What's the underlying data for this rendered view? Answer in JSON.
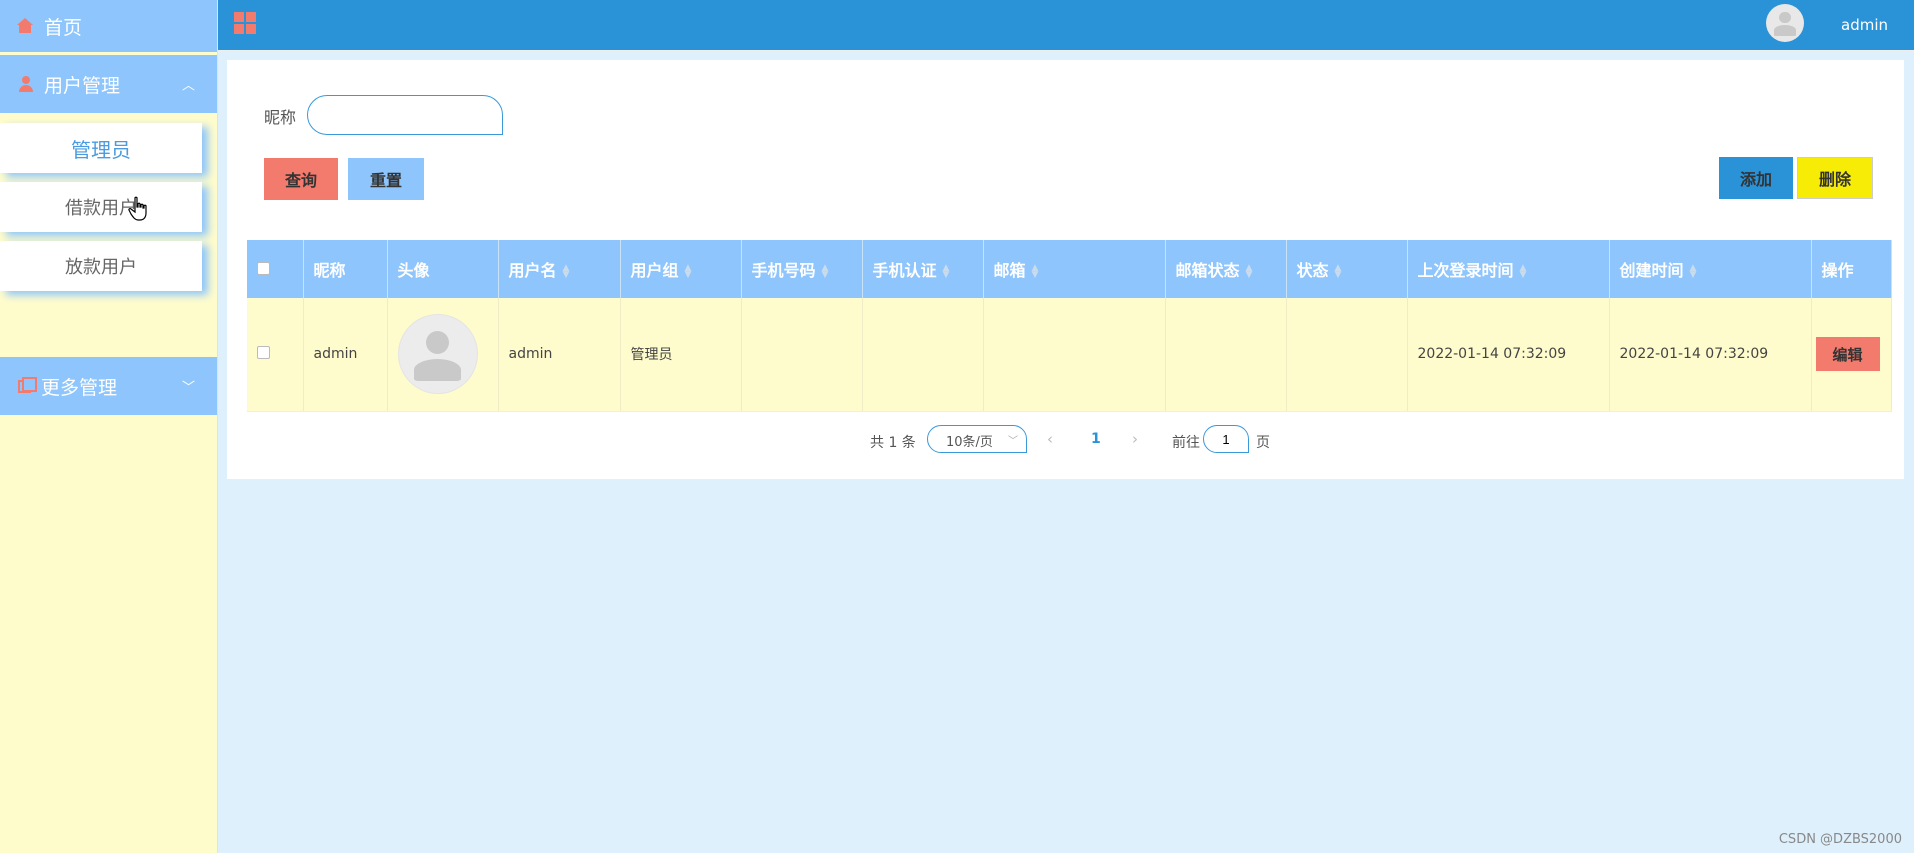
{
  "sidebar": {
    "home_label": "首页",
    "user_mgmt_label": "用户管理",
    "sub_items": [
      {
        "label": "管理员"
      },
      {
        "label": "借款用户"
      },
      {
        "label": "放款用户"
      }
    ],
    "more_label": "更多管理"
  },
  "header": {
    "username": "admin"
  },
  "search": {
    "label": "昵称",
    "value": "",
    "placeholder": ""
  },
  "buttons": {
    "query": "查询",
    "reset": "重置",
    "add": "添加",
    "delete": "删除"
  },
  "table": {
    "columns": [
      "昵称",
      "头像",
      "用户名",
      "用户组",
      "手机号码",
      "手机认证",
      "邮箱",
      "邮箱状态",
      "状态",
      "上次登录时间",
      "创建时间",
      "操作"
    ],
    "rows": [
      {
        "nickname": "admin",
        "username": "admin",
        "group": "管理员",
        "phone": "",
        "phone_verified": "",
        "email": "",
        "email_status": "",
        "status": "",
        "last_login": "2022-01-14 07:32:09",
        "created": "2022-01-14 07:32:09",
        "action_label": "编辑"
      }
    ]
  },
  "pagination": {
    "total_text": "共 1 条",
    "page_size": "10条/页",
    "current_page": "1",
    "goto_label": "前往",
    "goto_value": "1",
    "page_suffix": "页"
  },
  "watermark": "CSDN @DZBS2000",
  "colors": {
    "header_blue": "#2a92d6",
    "light_blue": "#8ec5fc",
    "sidebar_yellow": "#fffccc",
    "accent_red": "#f37b6e",
    "delete_yellow": "#f7ec06"
  }
}
